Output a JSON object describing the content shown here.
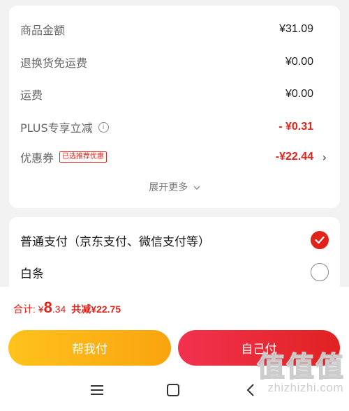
{
  "costs": {
    "rows": [
      {
        "label": "商品金额",
        "value": "¥31.09"
      },
      {
        "label": "退换货免运费",
        "value": "¥0.00"
      },
      {
        "label": "运费",
        "value": "¥0.00"
      },
      {
        "label": "PLUS专享立减",
        "value": "- ¥0.31",
        "info_icon": "i"
      },
      {
        "label": "优惠券",
        "value": "-¥22.44",
        "badge": "已选推荐优惠",
        "chevron": "›"
      }
    ],
    "expand_label": "展开更多",
    "expand_icon": "chevron-down-icon"
  },
  "payment": {
    "options": [
      {
        "label": "普通支付（京东支付、微信支付等）",
        "checked": true
      },
      {
        "label": "白条",
        "checked": false
      }
    ]
  },
  "footer": {
    "total_prefix": "合计: ¥",
    "total_integer": "8",
    "total_decimal": ".34",
    "discount_label": "共减¥22.75",
    "help_pay_label": "帮我付",
    "self_pay_label": "自己付"
  },
  "navbar": {
    "icons": [
      "menu-icon",
      "home-square-icon",
      "back-icon"
    ]
  },
  "watermark": {
    "chars": [
      "值",
      "值",
      "值"
    ],
    "text": "zhizhizhi.com"
  },
  "colors": {
    "accent_red": "#e2231a",
    "help_button": "#f9a40f",
    "self_button": "#e9283a"
  }
}
